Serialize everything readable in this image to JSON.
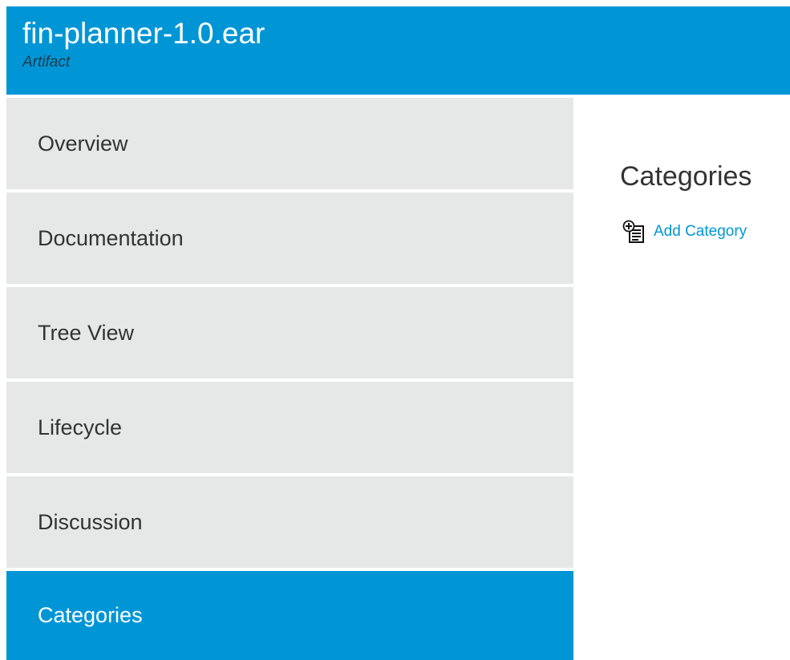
{
  "header": {
    "title": "fin-planner-1.0.ear",
    "subtitle": "Artifact"
  },
  "sidebar": {
    "items": [
      {
        "label": "Overview",
        "active": false
      },
      {
        "label": "Documentation",
        "active": false
      },
      {
        "label": "Tree View",
        "active": false
      },
      {
        "label": "Lifecycle",
        "active": false
      },
      {
        "label": "Discussion",
        "active": false
      },
      {
        "label": "Categories",
        "active": true
      }
    ]
  },
  "main": {
    "title": "Categories",
    "add_category_label": "Add Category",
    "add_category_icon": "add-document-icon"
  },
  "colors": {
    "accent": "#0096d6",
    "nav_background": "#e6e8e8",
    "text": "#333333",
    "link": "#0096d6"
  }
}
